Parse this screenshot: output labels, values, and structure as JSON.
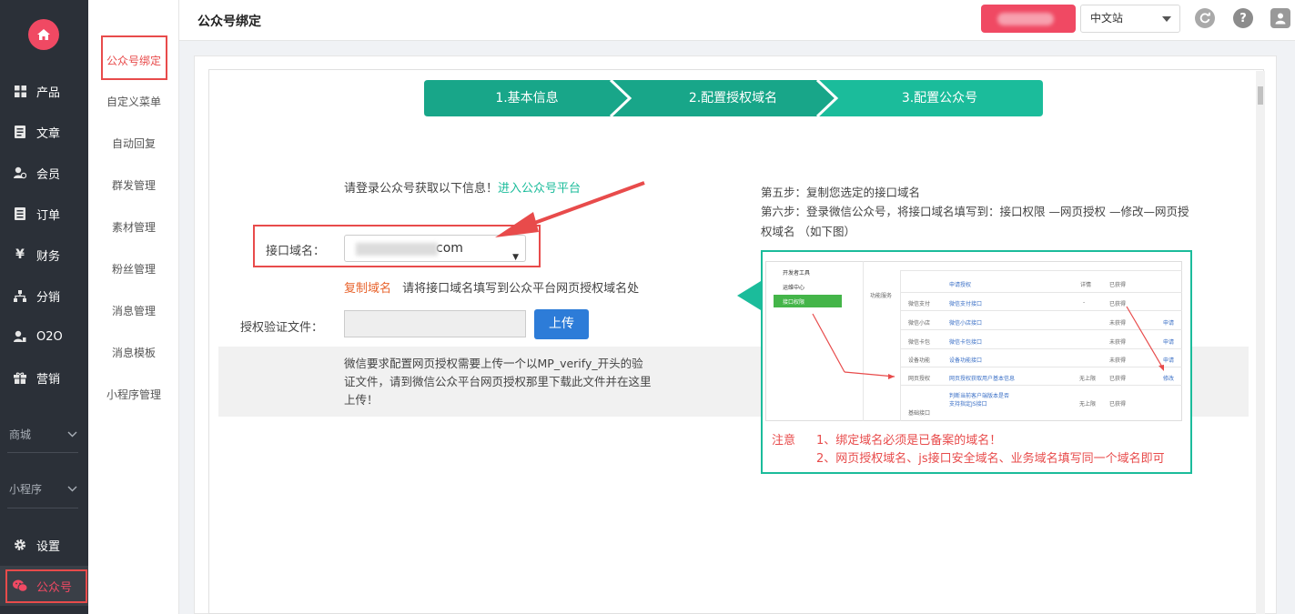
{
  "sidebar": {
    "items": [
      {
        "label": "产品",
        "icon": "grid-icon"
      },
      {
        "label": "文章",
        "icon": "document-icon"
      },
      {
        "label": "会员",
        "icon": "member-icon"
      },
      {
        "label": "订单",
        "icon": "order-list-icon"
      },
      {
        "label": "财务",
        "icon": "yen-icon"
      },
      {
        "label": "分销",
        "icon": "hierarchy-icon"
      },
      {
        "label": "O2O",
        "icon": "o2o-icon"
      },
      {
        "label": "营销",
        "icon": "gift-icon"
      }
    ],
    "groups": [
      {
        "label": "商城"
      },
      {
        "label": "小程序"
      }
    ],
    "settings": {
      "label": "设置"
    },
    "wechat": {
      "label": "公众号"
    }
  },
  "subnav": {
    "items": [
      {
        "label": "公众号绑定"
      },
      {
        "label": "自定义菜单"
      },
      {
        "label": "自动回复"
      },
      {
        "label": "群发管理"
      },
      {
        "label": "素材管理"
      },
      {
        "label": "粉丝管理"
      },
      {
        "label": "消息管理"
      },
      {
        "label": "消息模板"
      },
      {
        "label": "小程序管理"
      }
    ]
  },
  "header": {
    "title": "公众号绑定",
    "language": "中文站",
    "refresh_icon": "refresh-icon",
    "help_icon": "help-icon",
    "user_icon": "user-icon"
  },
  "steps": [
    {
      "label": "1.基本信息"
    },
    {
      "label": "2.配置授权域名"
    },
    {
      "label": "3.配置公众号"
    }
  ],
  "form": {
    "intro_text": "请登录公众号获取以下信息！",
    "intro_link": "进入公众号平台",
    "domain_label": "接口域名：",
    "domain_value": "com",
    "copy_link": "复制域名",
    "copy_hint": "请将接口域名填写到公众平台网页授权域名处",
    "verify_label": "授权验证文件：",
    "upload_button": "上传",
    "verify_note": "微信要求配置网页授权需要上传一个以MP_verify_开头的验证文件，请到微信公众平台网页授权那里下载此文件并在这里上传！"
  },
  "instructions": {
    "step5": "第五步：复制您选定的接口域名",
    "step6": "第六步：登录微信公众号，将接口域名填写到：接口权限 —网页授权 —修改—网页授权域名 （如下图）"
  },
  "guide": {
    "menu": [
      "开发者工具",
      "运维中心",
      "接口权限"
    ],
    "category": "功能服务",
    "rows": [
      {
        "name": "",
        "link": "申请授权",
        "quota": "详情",
        "status": "已获得",
        "action": ""
      },
      {
        "name": "微信支付",
        "link": "微信支付接口",
        "quota": "-",
        "status": "已获得",
        "action": ""
      },
      {
        "name": "微信小店",
        "link": "微信小店接口",
        "quota": "",
        "status": "未获得",
        "action": "申请"
      },
      {
        "name": "微信卡包",
        "link": "微信卡包接口",
        "quota": "",
        "status": "未获得",
        "action": "申请"
      },
      {
        "name": "设备功能",
        "link": "设备功能接口",
        "quota": "",
        "status": "未获得",
        "action": "申请"
      },
      {
        "name": "网页授权",
        "link": "网页授权获取用户基本信息",
        "quota": "无上限",
        "status": "已获得",
        "action": "修改"
      },
      {
        "name": "基础接口",
        "link": "判断当前客户端版本是否支持指定JS接口",
        "quota": "无上限",
        "status": "已获得",
        "action": ""
      }
    ],
    "note_label": "注意",
    "note1": "1、绑定域名必须是已备案的域名！",
    "note2": "2、网页授权域名、js接口安全域名、业务域名填写同一个域名即可"
  },
  "colors": {
    "accent_red": "#f04963",
    "step_green": "#1bbc9b",
    "step_green_dark": "#18a689",
    "upload_blue": "#2d7cd8"
  }
}
